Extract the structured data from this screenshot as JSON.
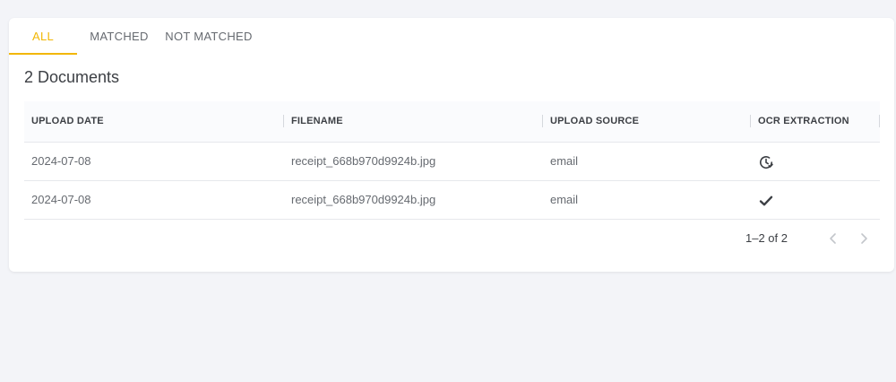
{
  "tabs": {
    "all": "ALL",
    "matched": "MATCHED",
    "not_matched": "NOT MATCHED"
  },
  "documents_title": "2 Documents",
  "table": {
    "headers": {
      "upload_date": "UPLOAD DATE",
      "filename": "FILENAME",
      "upload_source": "UPLOAD SOURCE",
      "ocr_extraction": "OCR EXTRACTION"
    },
    "rows": [
      {
        "upload_date": "2024-07-08",
        "filename": "receipt_668b970d9924b.jpg",
        "upload_source": "email",
        "ocr_status_icon": "clock-check-icon"
      },
      {
        "upload_date": "2024-07-08",
        "filename": "receipt_668b970d9924b.jpg",
        "upload_source": "email",
        "ocr_status_icon": "checkmark-icon"
      }
    ]
  },
  "pagination": {
    "range_text": "1–2 of 2",
    "prev_icon": "chevron-left-icon",
    "next_icon": "chevron-right-icon"
  },
  "colors": {
    "accent": "#f2b705",
    "page_background": "#f3f4f8",
    "text_primary": "#3c3f44",
    "text_secondary": "#666a70"
  }
}
